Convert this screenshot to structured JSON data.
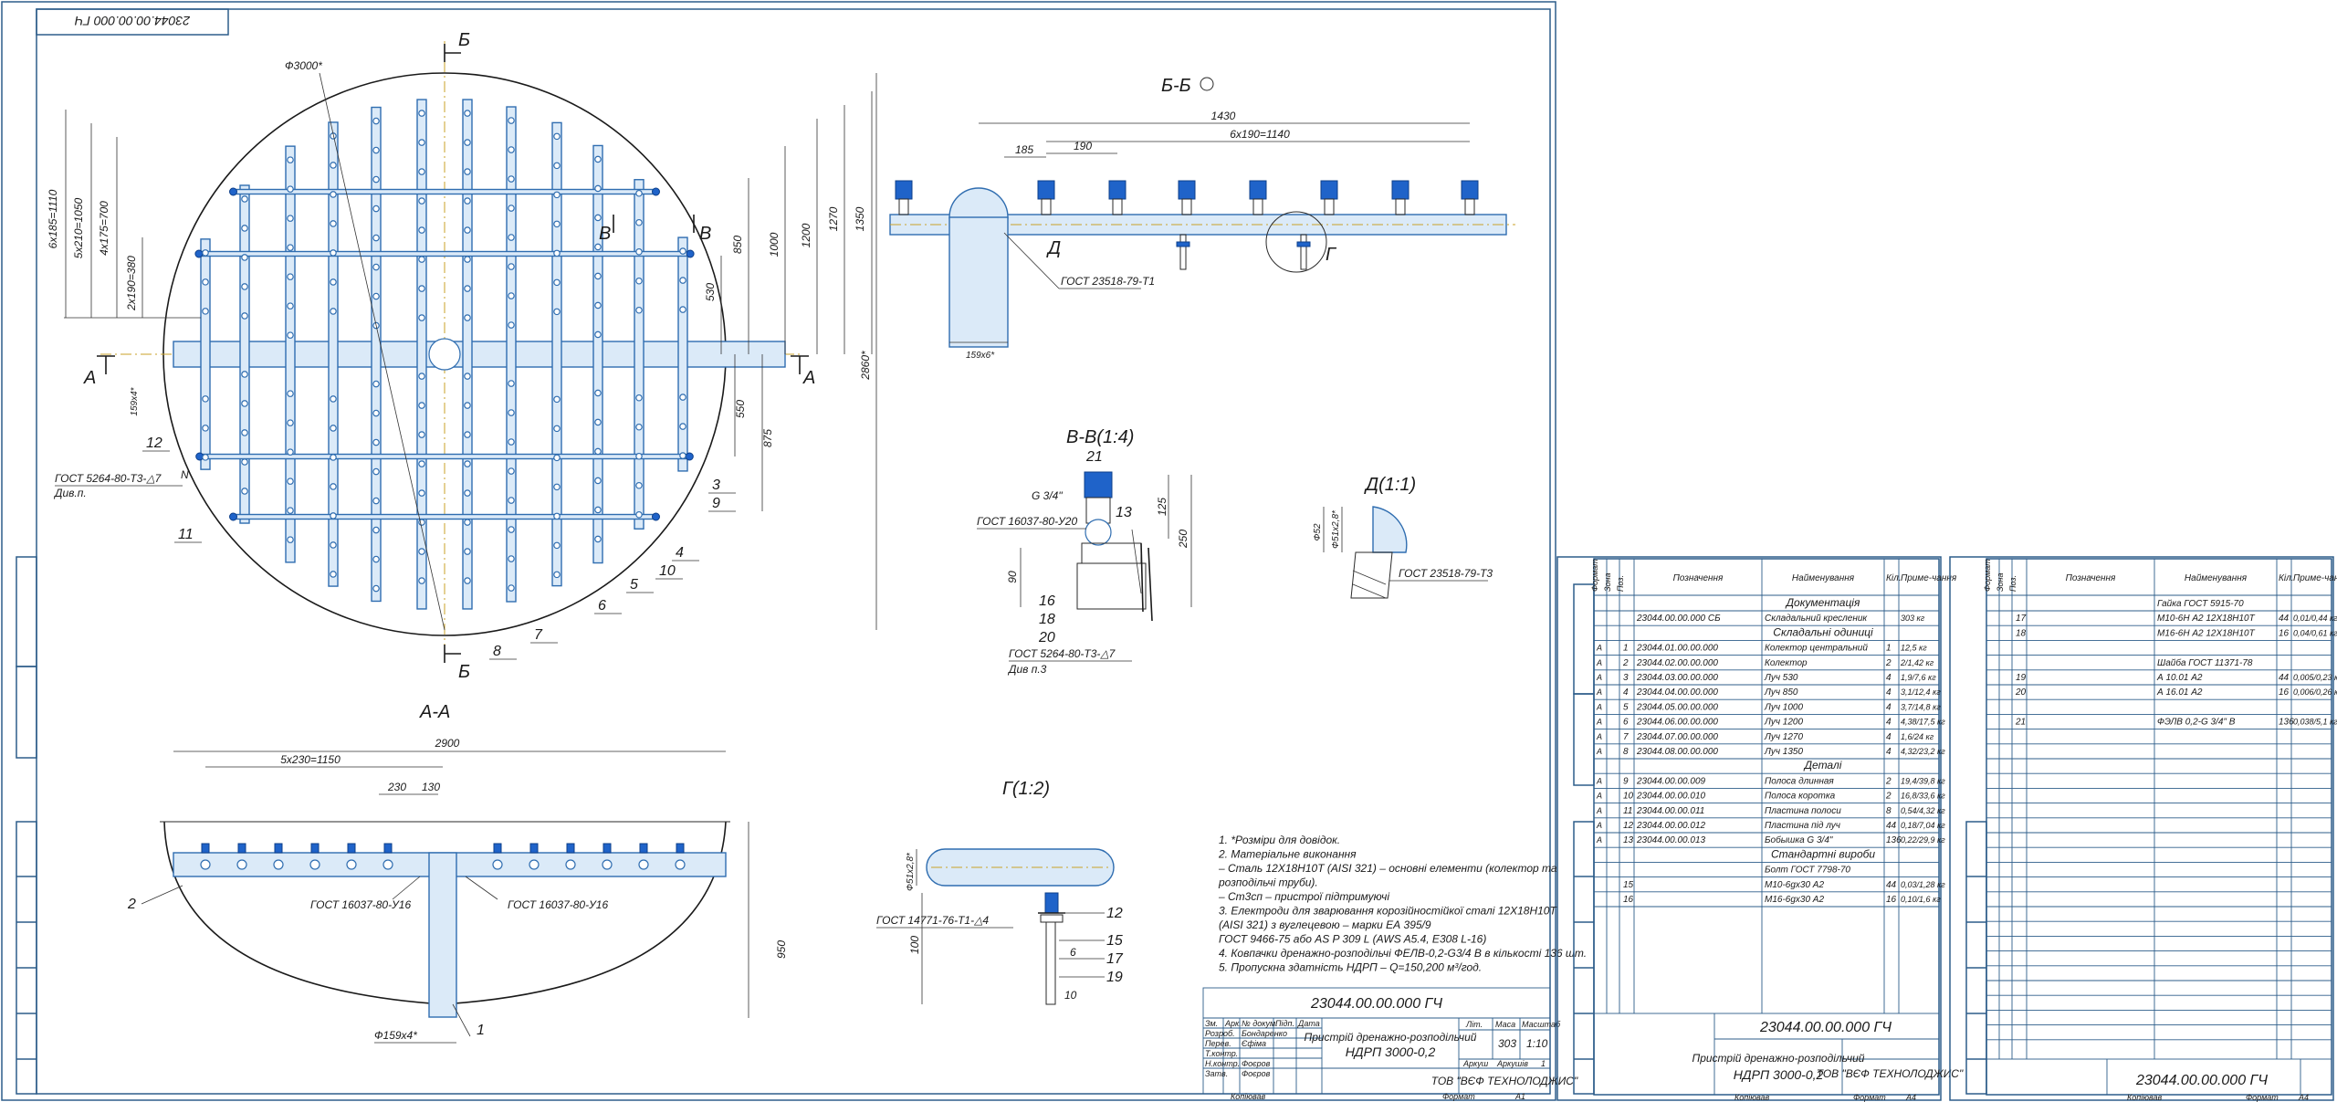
{
  "stamp_topleft": "23044.00.00.000 ГЧ",
  "views": {
    "main_label_b_top": "Б",
    "main_label_b_bottom": "Б",
    "main_label_a_left": "А",
    "main_label_a_right": "А",
    "main_label_v1": "В",
    "main_label_v2": "В",
    "bb_title": "Б-Б",
    "aa_title": "А-А",
    "vv_title": "В-В(1:4)",
    "d_title": "Д(1:1)",
    "g_title": "Г(1:2)",
    "d_callout": "Д",
    "g_callout": "Г"
  },
  "dims_main": {
    "diam": "Ф3000*",
    "d1": "6х185=1110",
    "d2": "5х210=1050",
    "d3": "4х175=700",
    "d4": "2х190=380",
    "d5": "159х4*",
    "h1": "850",
    "h2": "1000",
    "h3": "1200",
    "h4": "1270",
    "h5": "1350",
    "h6": "2860*",
    "h7": "530",
    "h8": "550",
    "h9": "875",
    "gost_weld": "ГОСТ 5264-80-Т3-△7",
    "weld_note": "Див.п.",
    "n_label": "N"
  },
  "balloons_main": [
    "12",
    "11",
    "3",
    "9",
    "4",
    "10",
    "5",
    "6",
    "7",
    "8"
  ],
  "dims_bb": {
    "total": "1430",
    "span": "6х190=1140",
    "d1": "185",
    "d2": "190",
    "pipe": "159х6*",
    "gost": "ГОСТ 23518-79-Т1"
  },
  "dims_aa": {
    "total": "2900",
    "span": "5х230=1150",
    "d1": "230",
    "d2": "130",
    "gost_left": "ГОСТ 16037-80-У16",
    "gost_right": "ГОСТ 16037-80-У16",
    "height": "950",
    "pipe": "Ф159х4*",
    "b1": "1",
    "b2": "2"
  },
  "dims_vv": {
    "thread": "G 3/4\"",
    "gost1": "ГОСТ 16037-80-У20",
    "gost2": "ГОСТ 5264-80-Т3-△7",
    "note": "Див п.3",
    "h1": "125",
    "h2": "250",
    "h3": "90",
    "balloons": [
      "21",
      "13",
      "16",
      "18",
      "20"
    ]
  },
  "dims_d": {
    "d1": "Ф52",
    "d2": "Ф51х2,8*",
    "gost": "ГОСТ 23518-79-Т3"
  },
  "dims_g": {
    "d1": "Ф51х2,8*",
    "gost": "ГОСТ 14771-76-Т1-△4",
    "h": "100",
    "w1": "6",
    "w2": "10",
    "balloons": [
      "12",
      "15",
      "17",
      "19"
    ]
  },
  "notes": [
    "1. *Розміри для довідок.",
    "2. Матеріальне виконання",
    "– Сталь 12Х18Н10Т (AISI 321) – основні елементи (колектор та",
    "розподільчі труби).",
    "– Ст3сп – пристрої підтримуючі",
    "3. Електроди для зварювання корозійностійкої сталі 12Х18Н10Т",
    "(AISI 321) з вуглецевою – марки ЕА 395/9",
    "ГОСТ 9466-75 або AS P 309 L (AWS A5.4, E308 L-16)",
    "4. Ковпачки дренажно-розподільчі ФЕЛВ-0,2-G3/4 В в кількості 136 шт.",
    "5. Пропускна здатність НДРП – Q=150,200 м³/год."
  ],
  "title_block_main": {
    "code": "23044.00.00.000 ГЧ",
    "name1": "Пристрій дренажно-розподільчий",
    "name2": "НДРП 3000-0,2",
    "lit": "Літ.",
    "mass_label": "Маса",
    "scale_label": "Масштаб",
    "mass": "303",
    "scale": "1:10",
    "sheet": "Аркуш",
    "sheets": "Аркушів",
    "sheets_val": "1",
    "company": "ТОВ \"ВЄФ ТЕХНОЛОДЖИС\"",
    "row_labels": [
      "Зм.",
      "Арк.",
      "№ докум.",
      "Підп.",
      "Дата"
    ],
    "roles": [
      "Розроб.",
      "Перев.",
      "Т.контр.",
      "Н.контр.",
      "Затв."
    ],
    "people": [
      "Бондаренко",
      "Єфіма",
      "",
      "Фоєров",
      "Фоєров"
    ],
    "copied": "Копіював",
    "format_label": "Формат",
    "format": "А1"
  },
  "spec": {
    "headers": [
      "Формат",
      "Зона",
      "Поз.",
      "Позначення",
      "Найменування",
      "Кіл.",
      "Приме-чання"
    ],
    "rows": [
      {
        "f": "",
        "z": "",
        "p": "",
        "code": "",
        "name": "Документація",
        "q": "",
        "n": "",
        "section": true
      },
      {
        "f": "",
        "z": "",
        "p": "",
        "code": "23044.00.00.000 СБ",
        "name": "Складальний кресленик",
        "q": "",
        "n": "303 кг",
        "section": false
      },
      {
        "f": "",
        "z": "",
        "p": "",
        "code": "",
        "name": "Складальні одиниці",
        "q": "",
        "n": "",
        "section": true
      },
      {
        "f": "А",
        "z": "",
        "p": "1",
        "code": "23044.01.00.00.000",
        "name": "Колектор центральний",
        "q": "1",
        "n": "12,5 кг",
        "section": false
      },
      {
        "f": "А",
        "z": "",
        "p": "2",
        "code": "23044.02.00.00.000",
        "name": "Колектор",
        "q": "2",
        "n": "2/1,42 кг",
        "section": false
      },
      {
        "f": "А",
        "z": "",
        "p": "3",
        "code": "23044.03.00.00.000",
        "name": "Луч 530",
        "q": "4",
        "n": "1,9/7,6 кг",
        "section": false
      },
      {
        "f": "А",
        "z": "",
        "p": "4",
        "code": "23044.04.00.00.000",
        "name": "Луч 850",
        "q": "4",
        "n": "3,1/12,4 кг",
        "section": false
      },
      {
        "f": "А",
        "z": "",
        "p": "5",
        "code": "23044.05.00.00.000",
        "name": "Луч 1000",
        "q": "4",
        "n": "3,7/14,8 кг",
        "section": false
      },
      {
        "f": "А",
        "z": "",
        "p": "6",
        "code": "23044.06.00.00.000",
        "name": "Луч 1200",
        "q": "4",
        "n": "4,38/17,5 кг",
        "section": false
      },
      {
        "f": "А",
        "z": "",
        "p": "7",
        "code": "23044.07.00.00.000",
        "name": "Луч 1270",
        "q": "4",
        "n": "1,6/24 кг",
        "section": false
      },
      {
        "f": "А",
        "z": "",
        "p": "8",
        "code": "23044.08.00.00.000",
        "name": "Луч 1350",
        "q": "4",
        "n": "4,32/23,2 кг",
        "section": false
      },
      {
        "f": "",
        "z": "",
        "p": "",
        "code": "",
        "name": "Деталі",
        "q": "",
        "n": "",
        "section": true
      },
      {
        "f": "А",
        "z": "",
        "p": "9",
        "code": "23044.00.00.009",
        "name": "Полоса длинная",
        "q": "2",
        "n": "19,4/39,8 кг",
        "section": false
      },
      {
        "f": "А",
        "z": "",
        "p": "10",
        "code": "23044.00.00.010",
        "name": "Полоса коротка",
        "q": "2",
        "n": "16,8/33,6 кг",
        "section": false
      },
      {
        "f": "А",
        "z": "",
        "p": "11",
        "code": "23044.00.00.011",
        "name": "Пластина полоси",
        "q": "8",
        "n": "0,54/4,32 кг",
        "section": false
      },
      {
        "f": "А",
        "z": "",
        "p": "12",
        "code": "23044.00.00.012",
        "name": "Пластина під луч",
        "q": "44",
        "n": "0,18/7,04 кг",
        "section": false
      },
      {
        "f": "А",
        "z": "",
        "p": "13",
        "code": "23044.00.00.013",
        "name": "Бобышка G 3/4\"",
        "q": "136",
        "n": "0,22/29,9 кг",
        "section": false
      },
      {
        "f": "",
        "z": "",
        "p": "",
        "code": "",
        "name": "Стандартні вироби",
        "q": "",
        "n": "",
        "section": true
      },
      {
        "f": "",
        "z": "",
        "p": "",
        "code": "",
        "name": "Болт ГОСТ 7798-70",
        "q": "",
        "n": "",
        "section": false
      },
      {
        "f": "",
        "z": "",
        "p": "15",
        "code": "",
        "name": "М10-6gх30 А2",
        "q": "44",
        "n": "0,03/1,28 кг",
        "section": false
      },
      {
        "f": "",
        "z": "",
        "p": "16",
        "code": "",
        "name": "М16-6gх30 А2",
        "q": "16",
        "n": "0,10/1,6 кг",
        "section": false
      }
    ],
    "title_code": "23044.00.00.000 ГЧ",
    "title_name1": "Пристрій дренажно-розподільчий",
    "title_name2": "НДРП 3000-0,2",
    "company": "ТОВ \"ВЄФ ТЕХНОЛОДЖИС\"",
    "copied": "Копіював",
    "format_label": "Формат",
    "format": "А4"
  },
  "spec2": {
    "rows": [
      {
        "p": "",
        "name": "Гайка ГОСТ 5915-70",
        "q": "",
        "n": ""
      },
      {
        "p": "17",
        "name": "М10-6Н А2 12Х18Н10Т",
        "q": "44",
        "n": "0,01/0,44 кг"
      },
      {
        "p": "18",
        "name": "М16-6Н А2 12Х18Н10Т",
        "q": "16",
        "n": "0,04/0,61 кг"
      },
      {
        "p": "",
        "name": "",
        "q": "",
        "n": ""
      },
      {
        "p": "",
        "name": "Шайба ГОСТ 11371-78",
        "q": "",
        "n": ""
      },
      {
        "p": "19",
        "name": "А 10.01 А2",
        "q": "44",
        "n": "0,005/0,23 кг"
      },
      {
        "p": "20",
        "name": "А 16.01 А2",
        "q": "16",
        "n": "0,006/0,26 кг"
      },
      {
        "p": "",
        "name": "",
        "q": "",
        "n": ""
      },
      {
        "p": "21",
        "name": "ФЭЛВ 0,2-G 3/4\" В",
        "q": "136",
        "n": "0,038/5,1 кг"
      }
    ],
    "title_code": "23044.00.00.000 ГЧ",
    "copied": "Копіював",
    "format_label": "Формат",
    "format": "А4"
  }
}
